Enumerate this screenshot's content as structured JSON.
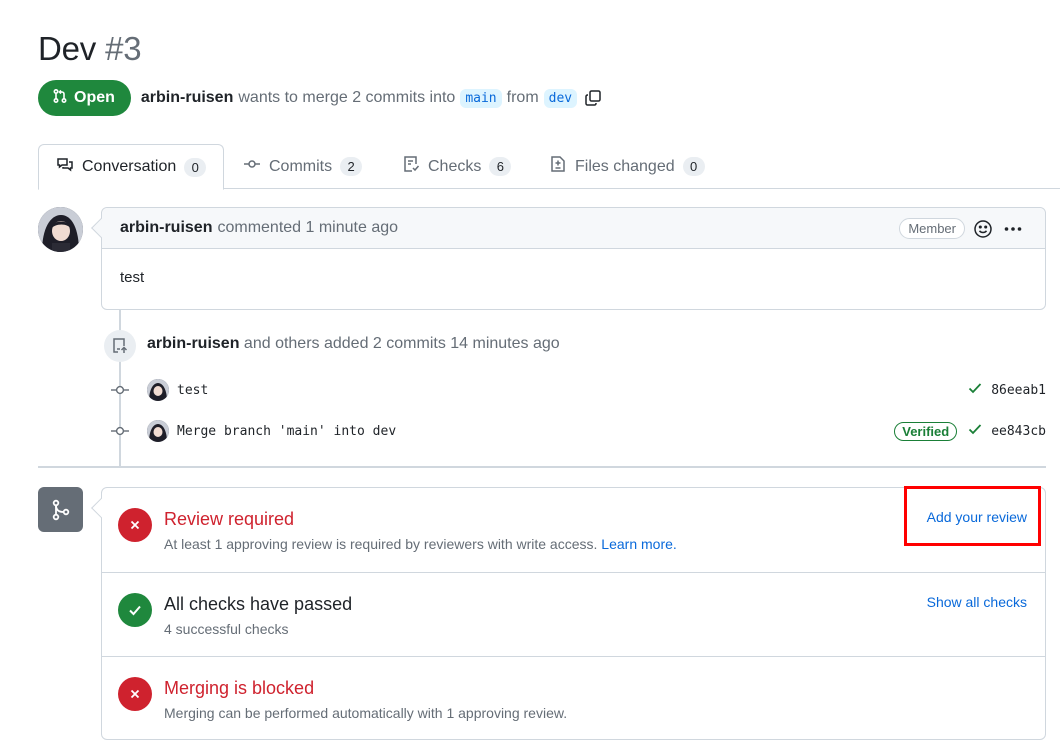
{
  "pr": {
    "title": "Dev",
    "number": "#3",
    "state": "Open",
    "author": "arbin-ruisen",
    "merge_text": "wants to merge 2 commits into",
    "base_branch": "main",
    "from_text": "from",
    "head_branch": "dev"
  },
  "tabs": [
    {
      "label": "Conversation",
      "count": "0"
    },
    {
      "label": "Commits",
      "count": "2"
    },
    {
      "label": "Checks",
      "count": "6"
    },
    {
      "label": "Files changed",
      "count": "0"
    }
  ],
  "comment": {
    "author": "arbin-ruisen",
    "action": "commented 1 minute ago",
    "role": "Member",
    "body": "test"
  },
  "commits_event": {
    "author": "arbin-ruisen",
    "text": "and others added 2 commits 14 minutes ago",
    "commits": [
      {
        "message": "test",
        "verified": "",
        "sha": "86eeab1"
      },
      {
        "message": "Merge branch 'main' into dev",
        "verified": "Verified",
        "sha": "ee843cb"
      }
    ]
  },
  "merge_box": {
    "review": {
      "title": "Review required",
      "subtitle": "At least 1 approving review is required by reviewers with write access.",
      "link": "Learn more.",
      "action": "Add your review"
    },
    "checks": {
      "title": "All checks have passed",
      "subtitle": "4 successful checks",
      "action": "Show all checks"
    },
    "blocked": {
      "title": "Merging is blocked",
      "subtitle": "Merging can be performed automatically with 1 approving review."
    }
  },
  "colors": {
    "open_green": "#1f883d",
    "danger_red": "#cf222e",
    "link_blue": "#0969da",
    "highlight_red": "#ff0000"
  }
}
